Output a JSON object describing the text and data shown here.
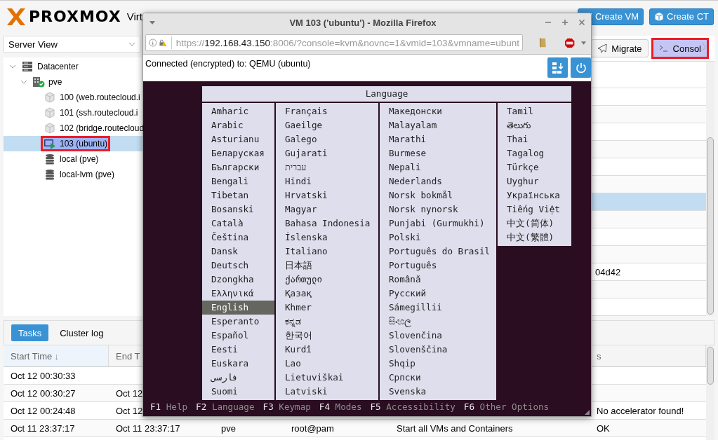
{
  "header": {
    "logo": "PROXMOX",
    "product": "Virt",
    "buttons": [
      {
        "kind": "vm",
        "label": "Create VM"
      },
      {
        "kind": "ct",
        "label": "Create CT"
      }
    ]
  },
  "sidebar": {
    "view": "Server View",
    "tree": [
      {
        "kind": "datacenter",
        "label": "Datacenter",
        "expanded": true,
        "selected": false,
        "children": [
          {
            "kind": "node",
            "label": "pve",
            "expanded": true,
            "selected": false,
            "children": [
              {
                "kind": "container",
                "label": "100 (web.routecloud.i",
                "selected": false
              },
              {
                "kind": "container",
                "label": "101 (ssh.routecloud.i",
                "selected": false
              },
              {
                "kind": "container",
                "label": "102 (bridge.routecloud",
                "selected": false
              },
              {
                "kind": "vm",
                "label": "103 (ubuntu)",
                "selected": true,
                "highlighted": true
              },
              {
                "kind": "storage",
                "label": "local (pve)",
                "selected": false
              },
              {
                "kind": "storage",
                "label": "local-lvm (pve)",
                "selected": false
              }
            ]
          }
        ]
      }
    ]
  },
  "toolbar": {
    "buttons": [
      {
        "kind": "migrate",
        "label": "Migrate",
        "selected": false
      },
      {
        "kind": "console",
        "label": "Consol",
        "selected": true,
        "highlighted": true
      }
    ]
  },
  "grid_rows": [
    {
      "selected": false
    },
    {
      "selected": false
    },
    {
      "selected": false
    },
    {
      "selected": false
    },
    {
      "selected": false
    },
    {
      "selected": false
    },
    {
      "selected": true
    },
    {
      "selected": false
    },
    {
      "selected": false
    },
    {
      "selected": false
    },
    {
      "selected": false,
      "text": "04d42"
    },
    {
      "selected": false
    },
    {
      "selected": false
    }
  ],
  "tasks_panel": {
    "tabs": [
      {
        "label": "Tasks",
        "selected": true
      },
      {
        "label": "Cluster log",
        "selected": false
      }
    ],
    "header": {
      "start_time": "Start Time",
      "sort_indicator": "↓",
      "end_time": "End T",
      "status": "s"
    },
    "rows": [
      {
        "start_time": "Oct 12 00:30:33"
      },
      {
        "start_time": "Oct 12 00:30:27",
        "end_time": "Oct 12"
      },
      {
        "start_time": "Oct 12 00:24:48",
        "end_time": "Oct 12",
        "status": "No accelerator found!"
      },
      {
        "start_time": "Oct 11 23:37:17",
        "end_time": "Oct 11 23:37:17",
        "node": "pve",
        "user": "root@pam",
        "description": "Start all VMs and Containers",
        "status": "OK"
      }
    ]
  },
  "browser": {
    "title": "VM 103 ('ubuntu') - Mozilla Firefox",
    "url": {
      "scheme": "https://",
      "host": "192.168.43.150",
      "rest": ":8006/?console=kvm&novnc=1&vmid=103&vmname=ubunt"
    },
    "novnc_status": "Connected (encrypted) to: QEMU (ubuntu)",
    "installer": {
      "title": "Language",
      "columns": [
        [
          {
            "label": "Amharic",
            "selected": false
          },
          {
            "label": "Arabic",
            "selected": false
          },
          {
            "label": "Asturianu",
            "selected": false
          },
          {
            "label": "Беларуская",
            "selected": false
          },
          {
            "label": "Български",
            "selected": false
          },
          {
            "label": "Bengali",
            "selected": false
          },
          {
            "label": "Tibetan",
            "selected": false
          },
          {
            "label": "Bosanski",
            "selected": false
          },
          {
            "label": "Català",
            "selected": false
          },
          {
            "label": "Čeština",
            "selected": false
          },
          {
            "label": "Dansk",
            "selected": false
          },
          {
            "label": "Deutsch",
            "selected": false
          },
          {
            "label": "Dzongkha",
            "selected": false
          },
          {
            "label": "Ελληνικά",
            "selected": false
          },
          {
            "label": "English",
            "selected": true
          },
          {
            "label": "Esperanto",
            "selected": false
          },
          {
            "label": "Español",
            "selected": false
          },
          {
            "label": "Eesti",
            "selected": false
          },
          {
            "label": "Euskara",
            "selected": false
          },
          {
            "label": "فارسی",
            "selected": false
          },
          {
            "label": "Suomi",
            "selected": false
          }
        ],
        [
          {
            "label": "Français",
            "selected": false
          },
          {
            "label": "Gaeilge",
            "selected": false
          },
          {
            "label": "Galego",
            "selected": false
          },
          {
            "label": "Gujarati",
            "selected": false
          },
          {
            "label": "עברית",
            "selected": false
          },
          {
            "label": "Hindi",
            "selected": false
          },
          {
            "label": "Hrvatski",
            "selected": false
          },
          {
            "label": "Magyar",
            "selected": false
          },
          {
            "label": "Bahasa Indonesia",
            "selected": false
          },
          {
            "label": "Íslenska",
            "selected": false
          },
          {
            "label": "Italiano",
            "selected": false
          },
          {
            "label": "日本語",
            "selected": false
          },
          {
            "label": "ქართული",
            "selected": false
          },
          {
            "label": "Қазақ",
            "selected": false
          },
          {
            "label": "Khmer",
            "selected": false
          },
          {
            "label": "ಕನ್ನಡ",
            "selected": false
          },
          {
            "label": "한국어",
            "selected": false
          },
          {
            "label": "Kurdî",
            "selected": false
          },
          {
            "label": "Lao",
            "selected": false
          },
          {
            "label": "Lietuviškai",
            "selected": false
          },
          {
            "label": "Latviski",
            "selected": false
          }
        ],
        [
          {
            "label": "Македонски",
            "selected": false
          },
          {
            "label": "Malayalam",
            "selected": false
          },
          {
            "label": "Marathi",
            "selected": false
          },
          {
            "label": "Burmese",
            "selected": false
          },
          {
            "label": "Nepali",
            "selected": false
          },
          {
            "label": "Nederlands",
            "selected": false
          },
          {
            "label": "Norsk bokmål",
            "selected": false
          },
          {
            "label": "Norsk nynorsk",
            "selected": false
          },
          {
            "label": "Punjabi (Gurmukhi)",
            "selected": false
          },
          {
            "label": "Polski",
            "selected": false
          },
          {
            "label": "Português do Brasil",
            "selected": false
          },
          {
            "label": "Português",
            "selected": false
          },
          {
            "label": "Română",
            "selected": false
          },
          {
            "label": "Русский",
            "selected": false
          },
          {
            "label": "Sámegillii",
            "selected": false
          },
          {
            "label": "සිංහල",
            "selected": false
          },
          {
            "label": "Slovenčina",
            "selected": false
          },
          {
            "label": "Slovenščina",
            "selected": false
          },
          {
            "label": "Shqip",
            "selected": false
          },
          {
            "label": "Српски",
            "selected": false
          },
          {
            "label": "Svenska",
            "selected": false
          }
        ],
        [
          {
            "label": "Tamil",
            "selected": false
          },
          {
            "label": "తెలుగు",
            "selected": false
          },
          {
            "label": "Thai",
            "selected": false
          },
          {
            "label": "Tagalog",
            "selected": false
          },
          {
            "label": "Türkçe",
            "selected": false
          },
          {
            "label": "Uyghur",
            "selected": false
          },
          {
            "label": "Українська",
            "selected": false
          },
          {
            "label": "Tiếng Việt",
            "selected": false
          },
          {
            "label": "中文(简体)",
            "selected": false
          },
          {
            "label": "中文(繁體)",
            "selected": false
          }
        ]
      ],
      "function_keys": [
        {
          "key": "F1",
          "label": "Help"
        },
        {
          "key": "F2",
          "label": "Language"
        },
        {
          "key": "F3",
          "label": "Keymap"
        },
        {
          "key": "F4",
          "label": "Modes"
        },
        {
          "key": "F5",
          "label": "Accessibility"
        },
        {
          "key": "F6",
          "label": "Other Options"
        }
      ]
    }
  }
}
